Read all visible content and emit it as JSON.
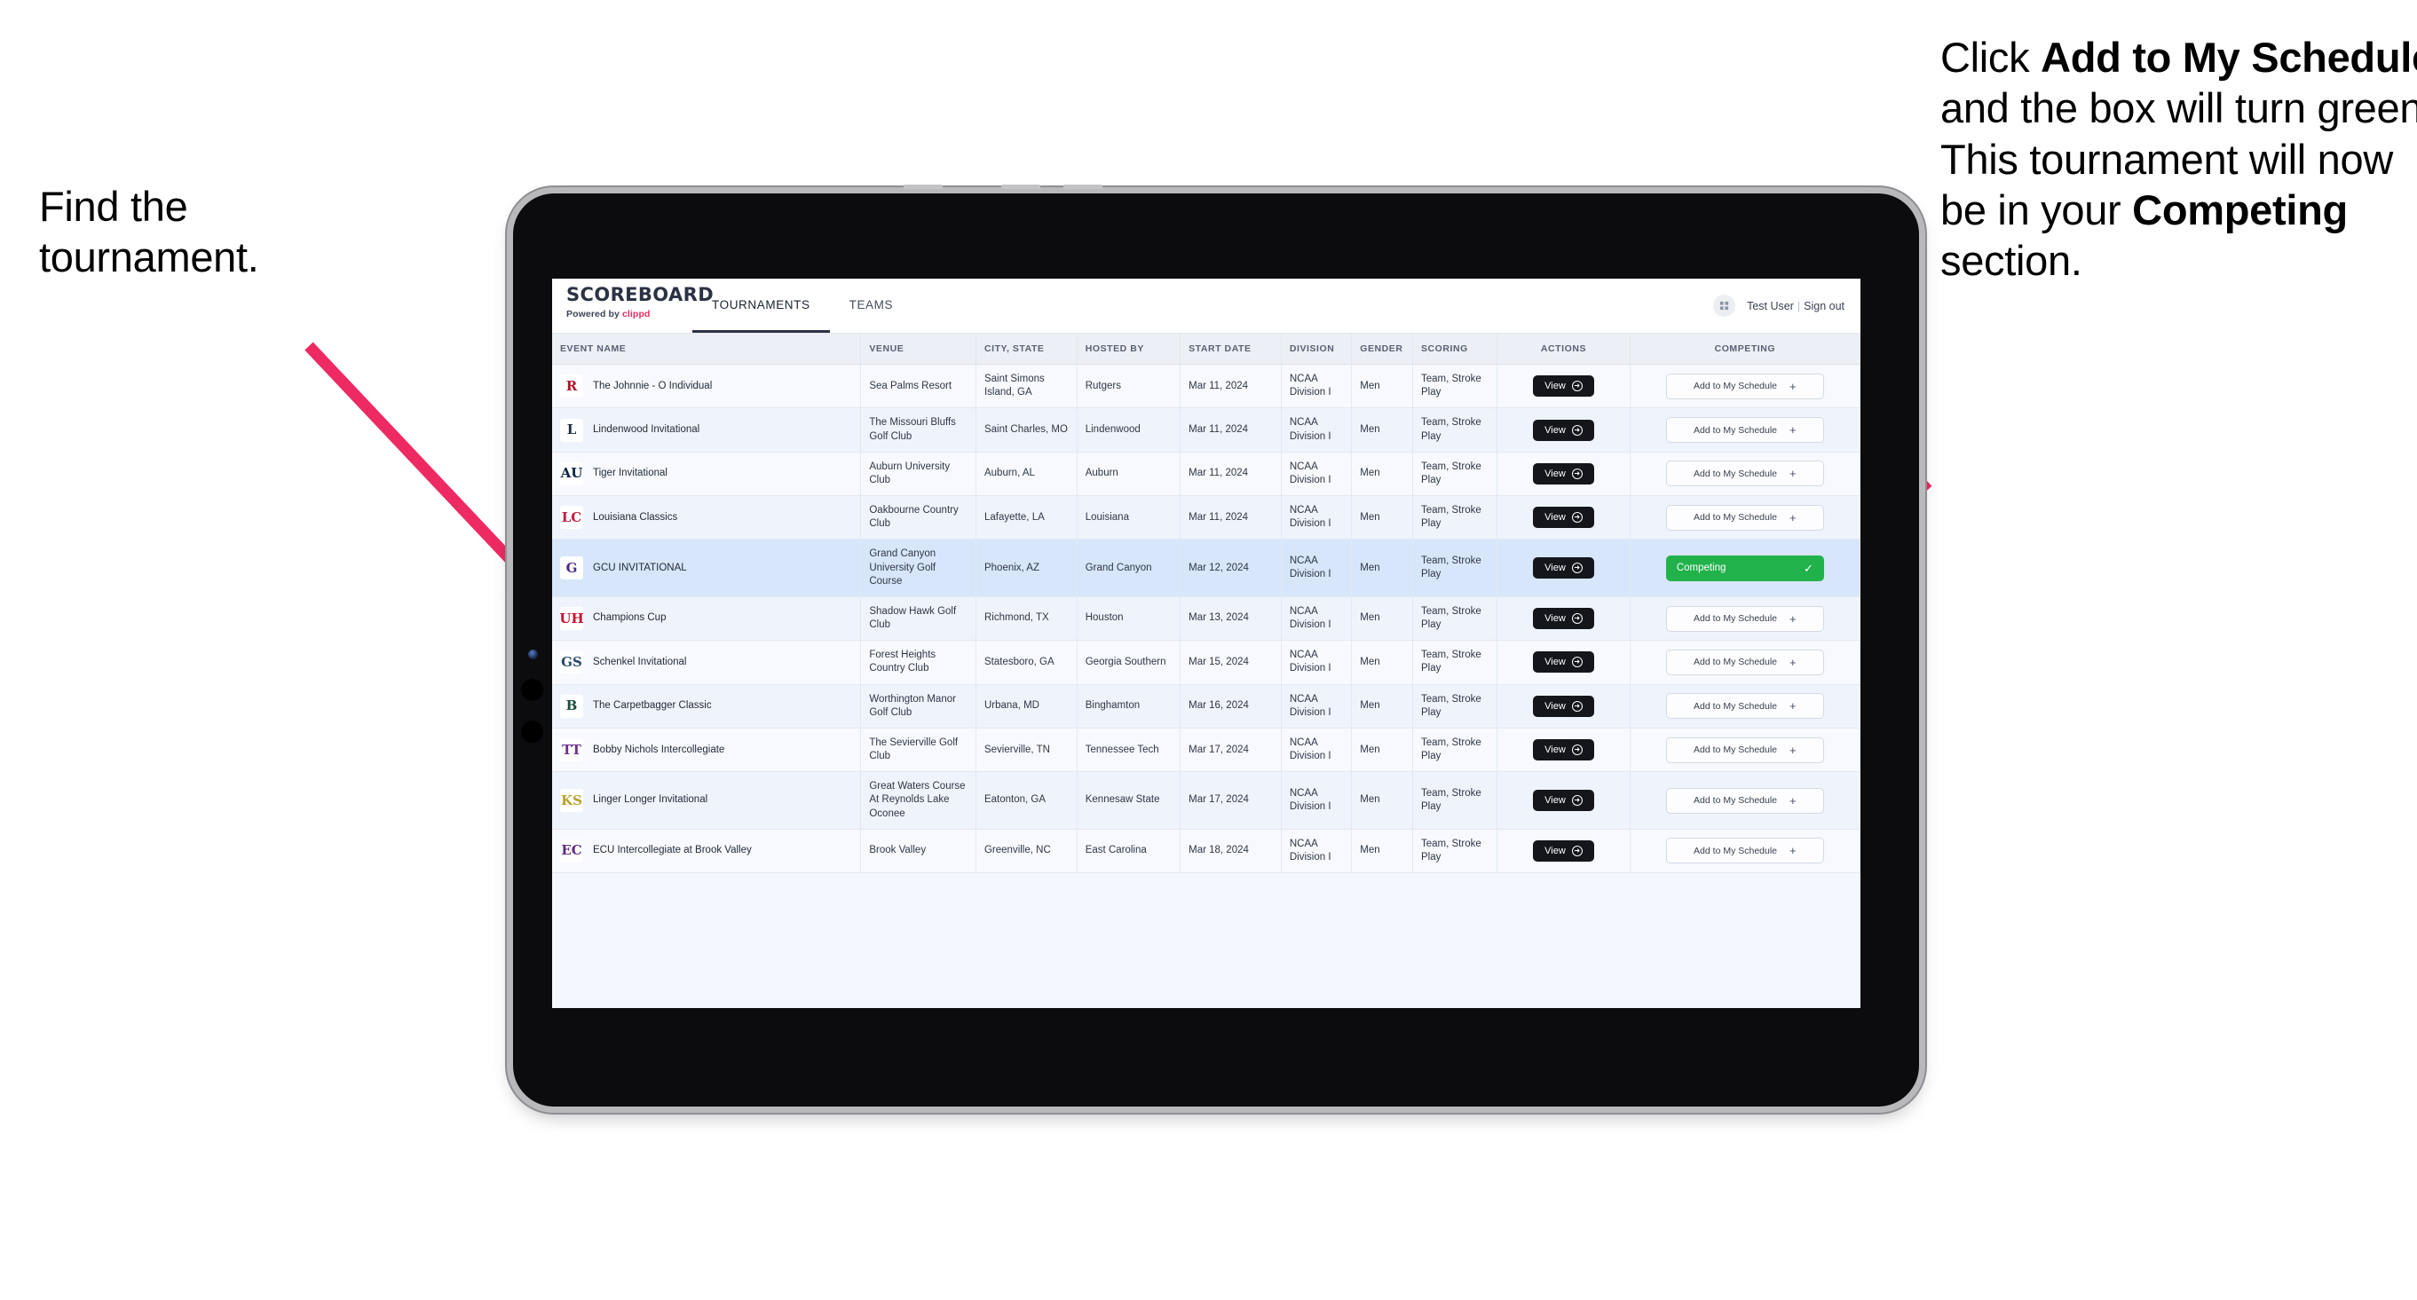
{
  "annotations": {
    "left": {
      "line1": "Find the",
      "line2": "tournament."
    },
    "right": {
      "prefix": "Click ",
      "bold1": "Add to My Schedule",
      "middle": " and the box will turn green. This tournament will now be in your ",
      "bold2": "Competing",
      "suffix": " section."
    },
    "arrow_color": "#ee2a62"
  },
  "app": {
    "brand": {
      "title": "SCOREBOARD",
      "powered_prefix": "Powered by ",
      "powered_brand": "clippd",
      "brand_color": "#ed2a61"
    },
    "nav": [
      {
        "label": "TOURNAMENTS",
        "active": true
      },
      {
        "label": "TEAMS",
        "active": false
      }
    ],
    "header_right": {
      "avatar_icon": "grid-icon",
      "user": "Test User",
      "separator": "|",
      "signout": "Sign out"
    }
  },
  "table": {
    "columns": [
      "EVENT NAME",
      "VENUE",
      "CITY, STATE",
      "HOSTED BY",
      "START DATE",
      "DIVISION",
      "GENDER",
      "SCORING",
      "ACTIONS",
      "COMPETING"
    ],
    "view_label": "View",
    "add_label": "Add to My Schedule",
    "competing_label": "Competing",
    "competing_color": "#22b24c",
    "rows": [
      {
        "logo_text": "R",
        "logo_bg": "#ffffff",
        "logo_fg": "#b01028",
        "event": "The Johnnie - O Individual",
        "venue": "Sea Palms Resort",
        "city": "Saint Simons Island, GA",
        "host": "Rutgers",
        "date": "Mar 11, 2024",
        "division": "NCAA Division I",
        "gender": "Men",
        "scoring": "Team, Stroke Play",
        "competing": false,
        "highlight": false
      },
      {
        "logo_text": "L",
        "logo_bg": "#ffffff",
        "logo_fg": "#1d2b3e",
        "event": "Lindenwood Invitational",
        "venue": "The Missouri Bluffs Golf Club",
        "city": "Saint Charles, MO",
        "host": "Lindenwood",
        "date": "Mar 11, 2024",
        "division": "NCAA Division I",
        "gender": "Men",
        "scoring": "Team, Stroke Play",
        "competing": false,
        "highlight": false
      },
      {
        "logo_text": "AU",
        "logo_bg": "#ffffff",
        "logo_fg": "#0b2341",
        "event": "Tiger Invitational",
        "venue": "Auburn University Club",
        "city": "Auburn, AL",
        "host": "Auburn",
        "date": "Mar 11, 2024",
        "division": "NCAA Division I",
        "gender": "Men",
        "scoring": "Team, Stroke Play",
        "competing": false,
        "highlight": false
      },
      {
        "logo_text": "LC",
        "logo_bg": "#ffffff",
        "logo_fg": "#c2193f",
        "event": "Louisiana Classics",
        "venue": "Oakbourne Country Club",
        "city": "Lafayette, LA",
        "host": "Louisiana",
        "date": "Mar 11, 2024",
        "division": "NCAA Division I",
        "gender": "Men",
        "scoring": "Team, Stroke Play",
        "competing": false,
        "highlight": false
      },
      {
        "logo_text": "G",
        "logo_bg": "#ffffff",
        "logo_fg": "#4b2a86",
        "event": "GCU INVITATIONAL",
        "venue": "Grand Canyon University Golf Course",
        "city": "Phoenix, AZ",
        "host": "Grand Canyon",
        "date": "Mar 12, 2024",
        "division": "NCAA Division I",
        "gender": "Men",
        "scoring": "Team, Stroke Play",
        "competing": true,
        "highlight": true
      },
      {
        "logo_text": "UH",
        "logo_bg": "#ffffff",
        "logo_fg": "#c8102e",
        "event": "Champions Cup",
        "venue": "Shadow Hawk Golf Club",
        "city": "Richmond, TX",
        "host": "Houston",
        "date": "Mar 13, 2024",
        "division": "NCAA Division I",
        "gender": "Men",
        "scoring": "Team, Stroke Play",
        "competing": false,
        "highlight": false
      },
      {
        "logo_text": "GS",
        "logo_bg": "#ffffff",
        "logo_fg": "#2a4a6b",
        "event": "Schenkel Invitational",
        "venue": "Forest Heights Country Club",
        "city": "Statesboro, GA",
        "host": "Georgia Southern",
        "date": "Mar 15, 2024",
        "division": "NCAA Division I",
        "gender": "Men",
        "scoring": "Team, Stroke Play",
        "competing": false,
        "highlight": false
      },
      {
        "logo_text": "B",
        "logo_bg": "#ffffff",
        "logo_fg": "#1a4d3c",
        "event": "The Carpetbagger Classic",
        "venue": "Worthington Manor Golf Club",
        "city": "Urbana, MD",
        "host": "Binghamton",
        "date": "Mar 16, 2024",
        "division": "NCAA Division I",
        "gender": "Men",
        "scoring": "Team, Stroke Play",
        "competing": false,
        "highlight": false
      },
      {
        "logo_text": "TT",
        "logo_bg": "#ffffff",
        "logo_fg": "#6a2f8f",
        "event": "Bobby Nichols Intercollegiate",
        "venue": "The Sevierville Golf Club",
        "city": "Sevierville, TN",
        "host": "Tennessee Tech",
        "date": "Mar 17, 2024",
        "division": "NCAA Division I",
        "gender": "Men",
        "scoring": "Team, Stroke Play",
        "competing": false,
        "highlight": false
      },
      {
        "logo_text": "KS",
        "logo_bg": "#ffffff",
        "logo_fg": "#b8a12e",
        "event": "Linger Longer Invitational",
        "venue": "Great Waters Course At Reynolds Lake Oconee",
        "city": "Eatonton, GA",
        "host": "Kennesaw State",
        "date": "Mar 17, 2024",
        "division": "NCAA Division I",
        "gender": "Men",
        "scoring": "Team, Stroke Play",
        "competing": false,
        "highlight": false
      },
      {
        "logo_text": "EC",
        "logo_bg": "#ffffff",
        "logo_fg": "#5c2a83",
        "event": "ECU Intercollegiate at Brook Valley",
        "venue": "Brook Valley",
        "city": "Greenville, NC",
        "host": "East Carolina",
        "date": "Mar 18, 2024",
        "division": "NCAA Division I",
        "gender": "Men",
        "scoring": "Team, Stroke Play",
        "competing": false,
        "highlight": false
      }
    ]
  }
}
